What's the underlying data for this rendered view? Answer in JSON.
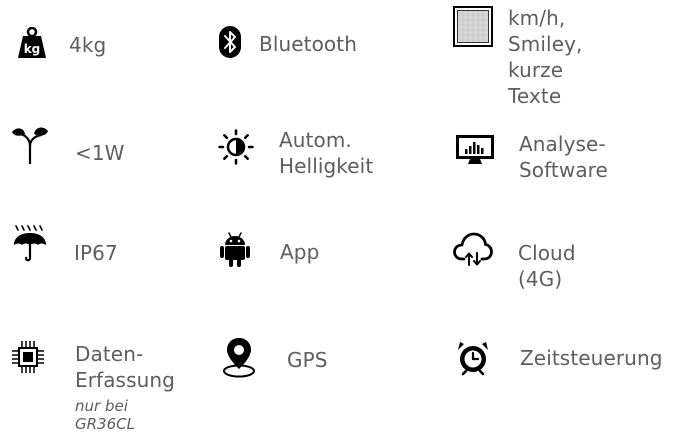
{
  "features": {
    "weight": {
      "label": "4kg",
      "icon": "weight-icon"
    },
    "bluetooth": {
      "label": "Bluetooth",
      "icon": "bluetooth-icon"
    },
    "display": {
      "label": "km/h, Smiley,\nkurze Texte",
      "icon": "display-panel-icon"
    },
    "power": {
      "label": "<1W",
      "icon": "plant-leaf-icon"
    },
    "brightness": {
      "label": "Autom.\nHelligkeit",
      "icon": "brightness-icon"
    },
    "analysis": {
      "label": "Analyse-\nSoftware",
      "icon": "monitor-chart-icon"
    },
    "protection": {
      "label": "IP67",
      "icon": "umbrella-rain-icon"
    },
    "app": {
      "label": "App",
      "icon": "android-icon"
    },
    "cloud": {
      "label": "Cloud (4G)",
      "icon": "cloud-sync-icon"
    },
    "data": {
      "label": "Daten-\nErfassung",
      "note": "nur bei GR36CL",
      "icon": "chip-icon"
    },
    "gps": {
      "label": "GPS",
      "icon": "location-pin-icon"
    },
    "timer": {
      "label": "Zeitsteuerung",
      "icon": "timer-icon"
    }
  }
}
